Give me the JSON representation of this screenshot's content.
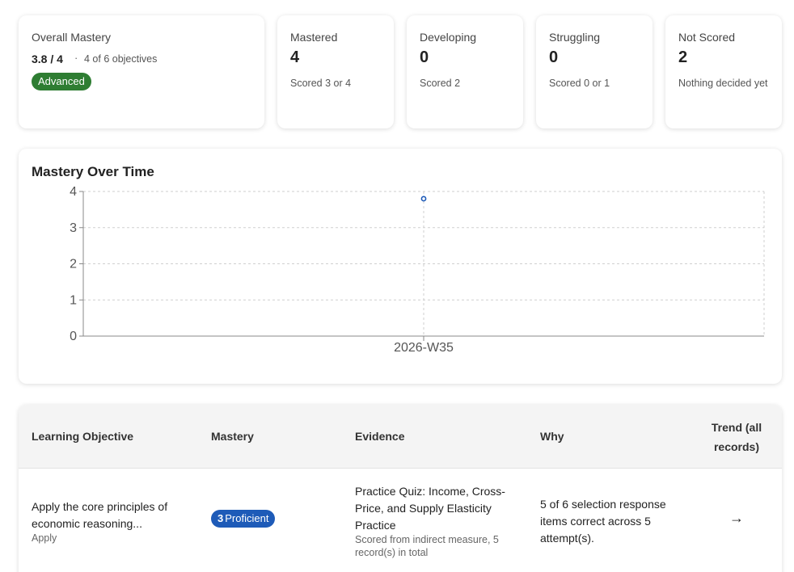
{
  "summary": {
    "overall": {
      "label": "Overall Mastery",
      "score": "3.8 / 4",
      "separator": "·",
      "objectives": "4 of 6 objectives",
      "badge": "Advanced",
      "badge_color": "#2e7d32"
    },
    "cards": [
      {
        "label": "Mastered",
        "value": "4",
        "sub": "Scored 3 or 4"
      },
      {
        "label": "Developing",
        "value": "0",
        "sub": "Scored 2"
      },
      {
        "label": "Struggling",
        "value": "0",
        "sub": "Scored 0 or 1"
      },
      {
        "label": "Not Scored",
        "value": "2",
        "sub": "Nothing decided yet"
      }
    ]
  },
  "chart": {
    "title": "Mastery Over Time"
  },
  "chart_data": {
    "type": "scatter",
    "title": "Mastery Over Time",
    "x": [
      "2026-W35"
    ],
    "y": [
      3.8
    ],
    "ylim": [
      0,
      4
    ],
    "yticks": [
      0,
      1,
      2,
      3,
      4
    ],
    "grid": true,
    "point_color": "#1e5bb8"
  },
  "table": {
    "headers": [
      "Learning Objective",
      "Mastery",
      "Evidence",
      "Why",
      "Trend (all records)"
    ],
    "rows": [
      {
        "objective": "Apply the core principles of economic reasoning...",
        "objective_sub": "Apply",
        "mastery_level": "3",
        "mastery_label": "Proficient",
        "mastery_color": "#1e5bb8",
        "evidence": "Practice Quiz: Income, Cross-Price, and Supply Elasticity Practice",
        "evidence_sub": "Scored from indirect measure, 5 record(s) in total",
        "why": "5 of 6 selection response items correct across 5 attempt(s).",
        "trend": "→"
      }
    ]
  }
}
